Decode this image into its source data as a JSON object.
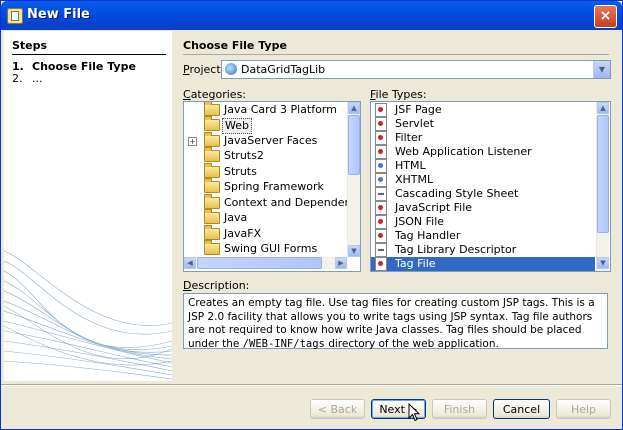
{
  "window": {
    "title": "New File",
    "close_label": "×"
  },
  "steps": {
    "heading": "Steps",
    "items": [
      {
        "num": "1.",
        "label": "Choose File Type"
      },
      {
        "num": "2.",
        "label": "..."
      }
    ]
  },
  "main": {
    "heading": "Choose File Type",
    "project_label_u": "P",
    "project_label_rest": "roject:",
    "project_value": "DataGridTagLib",
    "categories_label_u": "C",
    "categories_label_rest": "ategories:",
    "filetypes_label_u": "F",
    "filetypes_label_rest": "ile Types:",
    "categories": [
      "Java Card 3 Platform",
      "Web",
      "JavaServer Faces",
      "Struts2",
      "Struts",
      "Spring Framework",
      "Context and Dependency Inje",
      "Java",
      "JavaFX",
      "Swing GUI Forms"
    ],
    "file_types": [
      "JSF Page",
      "Servlet",
      "Filter",
      "Web Application Listener",
      "HTML",
      "XHTML",
      "Cascading Style Sheet",
      "JavaScript File",
      "JSON File",
      "Tag Handler",
      "Tag Library Descriptor",
      "Tag File"
    ],
    "selected_file_type": "Tag File",
    "selected_category": "Web",
    "description_label_u": "D",
    "description_label_rest": "escription:",
    "description_1": "Creates an empty tag file. Use tag files for creating custom JSP tags. This is a JSP 2.0 facility that allows you to write tags using JSP syntax. Tag file authors are not required to know how write Java classes. Tag files should be placed under the ",
    "description_path": "/WEB-INF/tags",
    "description_2": " directory of the web application."
  },
  "buttons": {
    "back": "< Back",
    "next": "Next >",
    "finish": "Finish",
    "cancel": "Cancel",
    "help": "Help"
  }
}
